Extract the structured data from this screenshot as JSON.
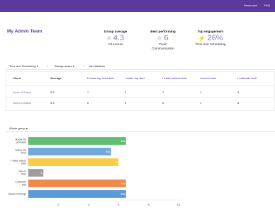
{
  "topnav": {
    "resources": "Resources",
    "faq": "FAQ"
  },
  "page": {
    "title": "My Admin Team"
  },
  "stats": {
    "group_average": {
      "label": "Group average",
      "value": "4.3",
      "sub": "All Arenas"
    },
    "best_performing": {
      "label": "Best performing",
      "value": "6",
      "sub_line1": "Team",
      "sub_line2": "Communication"
    },
    "top_engagement": {
      "label": "Top engagement",
      "value": "26%",
      "sub": "Time and Scheduling"
    }
  },
  "filters": {
    "arena": "Time and Scheduling",
    "frequency": "Always aware",
    "initiatives": "All initiatives",
    "separator": "/"
  },
  "table": {
    "headers": [
      "Client",
      "Average",
      "I know my schedule",
      "I value my time",
      "I value others time",
      "I am on time",
      "I estimate well"
    ],
    "rows": [
      [
        "Demo 3 Admin",
        "5.5",
        "7",
        "5",
        "7",
        "1",
        "5"
      ],
      [
        "Demo 2 Admin",
        "5.5",
        "6",
        "6",
        "5",
        "1",
        "8"
      ]
    ]
  },
  "group_selector": {
    "label": "Whole group"
  },
  "colors": {
    "accent": "#5b3a9b"
  },
  "chart_data": {
    "type": "bar",
    "orientation": "horizontal",
    "categories": [
      "I know my schedule",
      "I value my time",
      "I value others time",
      "I am on time",
      "I estimate well",
      "cancel meetings"
    ],
    "values": [
      6.5,
      5.5,
      6,
      1,
      6.5,
      6.5
    ],
    "value_labels": [
      "6.5",
      "5.5",
      "6",
      "1",
      "6.5",
      "6.5"
    ],
    "colors": [
      "#5fbd74",
      "#6fa8dc",
      "#f7cd46",
      "#9e9e9e",
      "#f08a4b",
      "#5b9bd5"
    ],
    "xlim": [
      0,
      10
    ],
    "xticks": [
      "2",
      "4",
      "6",
      "8",
      "10"
    ],
    "xlabel": "",
    "ylabel": "",
    "title": ""
  }
}
